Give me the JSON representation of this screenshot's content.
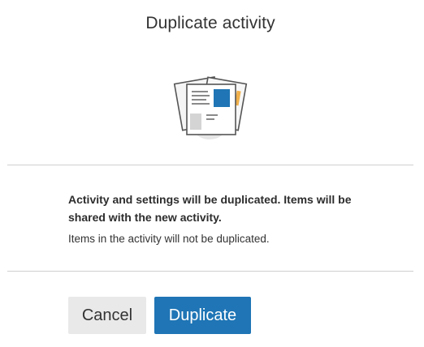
{
  "dialog": {
    "title": "Duplicate activity",
    "illustration": "duplicate-documents-icon",
    "message": "Activity and settings will be duplicated. Items will be shared with the new activity.",
    "note": "Items in the activity will not be duplicated.",
    "cancel_label": "Cancel",
    "confirm_label": "Duplicate",
    "colors": {
      "primary": "#1f75b5",
      "secondary_button": "#e9e9e9",
      "accent_document": "#f0b04a"
    }
  }
}
